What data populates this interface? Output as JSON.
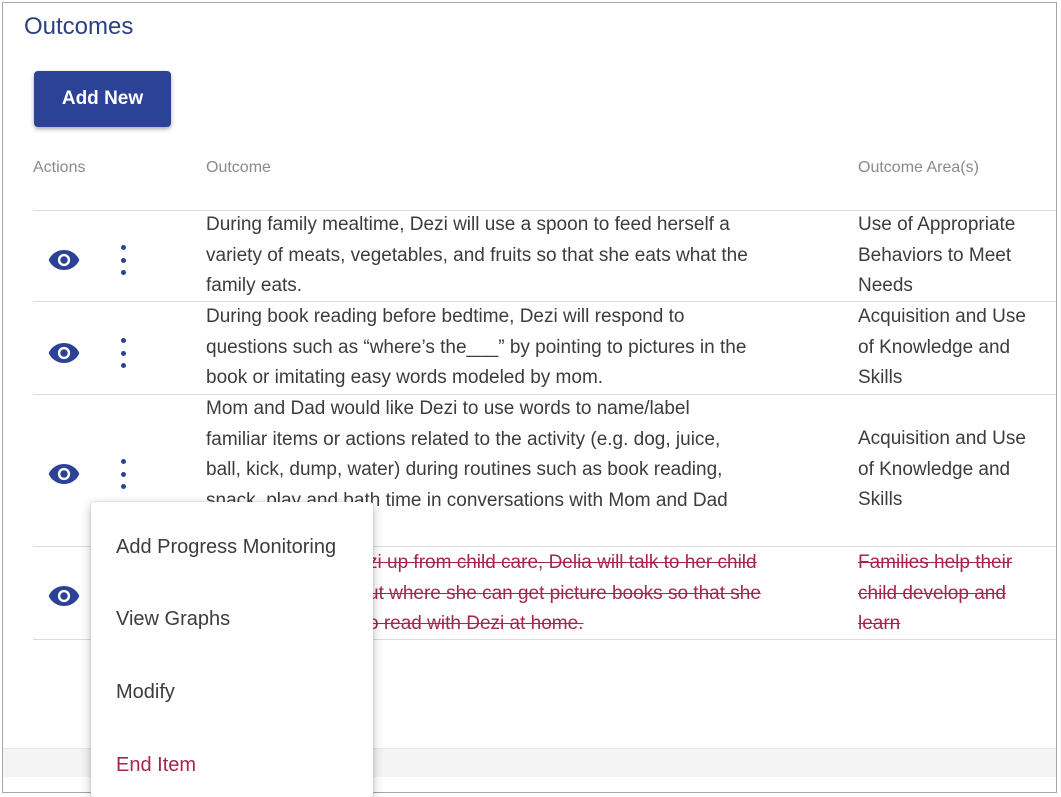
{
  "page": {
    "title": "Outcomes",
    "add_new_label": "Add New"
  },
  "table": {
    "headers": {
      "actions": "Actions",
      "outcome": "Outcome",
      "area": "Outcome Area(s)"
    },
    "rows": [
      {
        "outcome_lines": [
          "During family mealtime, Dezi will use a spoon to feed herself a",
          "variety of meats, vegetables, and fruits so that she eats what the",
          "family eats."
        ],
        "area_lines": [
          "Use of Appropriate",
          "Behaviors to Meet",
          "Needs"
        ],
        "ended": false
      },
      {
        "outcome_lines": [
          "During book reading before bedtime, Dezi will respond to",
          "questions such as “where’s the___” by pointing to pictures in the",
          "book or imitating easy words modeled by mom."
        ],
        "area_lines": [
          "Acquisition and Use",
          "of Knowledge and",
          "Skills"
        ],
        "ended": false
      },
      {
        "outcome_lines": [
          "Mom and Dad would like Dezi to use words to name/label",
          "familiar items or actions related to the activity (e.g. dog, juice,",
          "ball, kick, dump, water) during routines such as book reading,",
          "snack, play and bath time in conversations with Mom and Dad"
        ],
        "area_lines": [
          "Acquisition and Use",
          "of Knowledge and",
          "Skills"
        ],
        "ended": false
      },
      {
        "outcome_lines": [
          "zi up from child care, Delia will talk to her child",
          "ut where she can get picture books so that she",
          "o read with Dezi at home."
        ],
        "area_lines": [
          "Families help their",
          "child develop and",
          "learn"
        ],
        "ended": true
      }
    ]
  },
  "menu": {
    "items": [
      {
        "label": "Add Progress Monitoring"
      },
      {
        "label": "View Graphs"
      },
      {
        "label": "Modify"
      },
      {
        "label": "End Item"
      }
    ]
  },
  "colors": {
    "primary": "#2b4296",
    "title": "#2b4180",
    "ended": "#a5264b",
    "text": "#3c3c3c"
  },
  "icons": {
    "view": "eye-icon",
    "actions": "kebab-menu-icon"
  }
}
